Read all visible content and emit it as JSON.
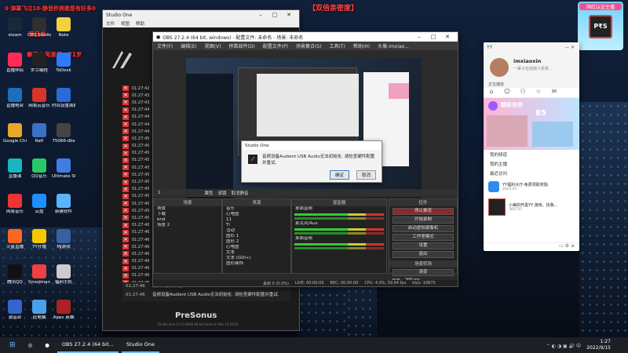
{
  "desktop": {
    "banners": [
      "0 弹幕飞过10-静音秒换歌是有好多0",
      "节目单",
      "秦腔上两滚流：21岁"
    ],
    "center_banner": "【双倍亲密度】",
    "icons": [
      {
        "label": "steam",
        "color": "#1b2838"
      },
      {
        "label": "OBS Studio 电子白板",
        "color": "#302e31"
      },
      {
        "label": "Note",
        "color": "#f2d13c"
      },
      {
        "label": "直播伴侣",
        "color": "#ff2a55"
      },
      {
        "label": "罗兰编程",
        "color": "#222"
      },
      {
        "label": "ToDesk",
        "color": "#2b7bff"
      },
      {
        "label": "直播电台",
        "color": "#1d6fbe"
      },
      {
        "label": "网易云音乐",
        "color": "#d8342c"
      },
      {
        "label": "时间设置面板",
        "color": "#2a6bd6"
      },
      {
        "label": "Google Chrome",
        "color": "#e6a82a"
      },
      {
        "label": "Rafi",
        "color": "#3a72c4"
      },
      {
        "label": "75066-dbs",
        "color": "#444"
      },
      {
        "label": "直播课",
        "color": "#17b6c0"
      },
      {
        "label": "QQ音乐",
        "color": "#27c96a"
      },
      {
        "label": "Ultimate Studio",
        "color": "#3f7ee0"
      },
      {
        "label": "网易音乐",
        "color": "#e33"
      },
      {
        "label": "云盘",
        "color": "#1e90ff"
      },
      {
        "label": "新建软件",
        "color": "#5bb3ff"
      },
      {
        "label": "火星直播",
        "color": "#ff6622"
      },
      {
        "label": "YY开播",
        "color": "#f7c600"
      },
      {
        "label": "MJ游戏",
        "color": "#3b5f9e"
      },
      {
        "label": "腾讯QQ",
        "color": "#111"
      },
      {
        "label": "Smodman",
        "color": "#f04040"
      },
      {
        "label": "福利手机",
        "color": "#ccc"
      },
      {
        "label": "调音台",
        "color": "#3366cc"
      },
      {
        "label": "此电脑",
        "color": "#4aa0ea"
      },
      {
        "label": "Apex 英雄",
        "color": "#aa2222"
      }
    ]
  },
  "studio_window": {
    "title": "Studio One",
    "menu": [
      "文件",
      "视图",
      "帮助"
    ],
    "brand": "PreSonus",
    "footer": "Studio One 5.0.0.6896 64-bit build on Mar 10 2019",
    "log_times": [
      "01:27:42",
      "01:27:43",
      "01:27:43",
      "01:27:44",
      "01:27:44",
      "01:27:44",
      "01:27:44",
      "01:27:45",
      "01:27:45",
      "01:27:45",
      "01:27:45",
      "01:27:45",
      "01:27:45",
      "01:27:45",
      "01:27:45",
      "01:27:45",
      "01:27:45",
      "01:27:45",
      "01:27:45",
      "01:27:46",
      "01:27:46",
      "01:27:46",
      "01:27:46",
      "01:27:46",
      "01:27:46",
      "01:27:46",
      "01:27:46",
      "01:27:46",
      "01:27:46"
    ],
    "messages": [
      {
        "time": "01:27:46",
        "text": "切换为音频设备Audient USB Audio..."
      },
      {
        "time": "01:27:46",
        "text": "音频设备Audient USB Audio无法初始化. 请检查硬件配置并重试."
      }
    ]
  },
  "obs_window": {
    "title": "OBS 27.2.4 (64 bit, windows) - 配置文件: 未命名 - 场景: 未命名",
    "menu": [
      "文件(F)",
      "编辑(E)",
      "视图(V)",
      "停靠部件(D)",
      "配置文件(P)",
      "场景集合(S)",
      "工具(T)",
      "帮助(H)",
      "头像-imxiao..."
    ],
    "source_bar": {
      "name": "1",
      "buttons": [
        "属性",
        "滤镜",
        "取消静音"
      ]
    },
    "panels": {
      "scenes": {
        "title": "场景",
        "items": [
          "场景",
          "下载",
          "end",
          "场景 2"
        ]
      },
      "sources": {
        "title": "来源",
        "items": [
          "音乐",
          "心电图",
          "11",
          "Ti",
          "活动",
          "图形 1",
          "图形 2",
          "心电图",
          "文本",
          "文本 (GDI+)",
          "图形装饰"
        ]
      },
      "mixer": {
        "title": "混音器",
        "items": [
          "桌面音频",
          "麦克风/Aux",
          "桌面音频"
        ]
      },
      "controls": {
        "title": "控件",
        "items": [
          "停止推流",
          "开始录制",
          "启动虚拟摄像机",
          "工作室模式",
          "设置",
          "退出"
        ],
        "active": "停止推流"
      },
      "transitions": {
        "title": "场景转场",
        "type": "渐变",
        "duration": "时长",
        "duration_value": "300 ms"
      }
    },
    "status": {
      "dropped": "丢帧 0 (0.0%)",
      "live": "LIVE: 00:00:00",
      "rec": "REC: 00:00:00",
      "cpu": "CPU: 4.0%, 59.94 fps",
      "kbps": "kb/s: 10875"
    }
  },
  "dialog": {
    "title": "Studio One",
    "message": "音频设备Audient USB Audio无法初始化. 请检查硬件配置并重试.",
    "ok": "确定",
    "cancel": "取消"
  },
  "chat_panel": {
    "username": "imxiaoxin",
    "bio": "一辈子在追随人愿意...",
    "section": "正在播放",
    "banner_title": "精彩世界",
    "banner_number": "85",
    "items": [
      "我的频道",
      "我的主播",
      "最近访问"
    ],
    "promo_title": "YY福利大厅-免费领取奖励",
    "promo_sub": "2023.0+",
    "game_title": "小美的开黑YY 游戏、找我...",
    "game_sub": "385731"
  },
  "badge": {
    "label": "网红认证主播"
  },
  "taskbar": {
    "apps": [
      {
        "label": "OBS 27.2.4 (64 bit..."
      },
      {
        "label": "Studio One"
      }
    ],
    "time": "1:27",
    "date": "2022/9/15"
  }
}
